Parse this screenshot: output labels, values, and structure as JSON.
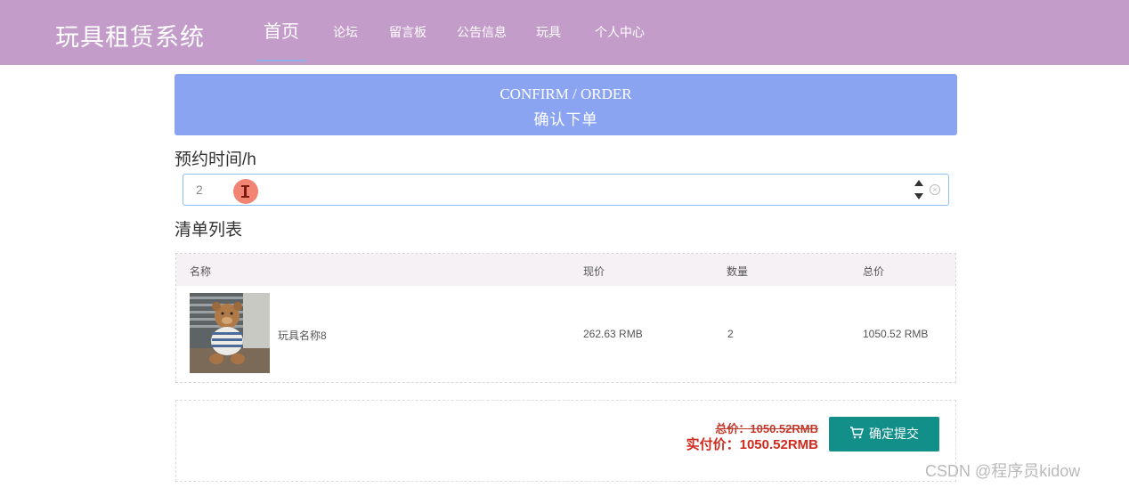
{
  "header": {
    "brand": "玩具租赁系统",
    "nav": [
      "首页",
      "论坛",
      "留言板",
      "公告信息",
      "玩具",
      "个人中心"
    ],
    "active_index": 0
  },
  "banner": {
    "title_en": "CONFIRM / ORDER",
    "title_cn": "确认下单"
  },
  "booking": {
    "label": "预约时间/h",
    "value": "2"
  },
  "list": {
    "label": "清单列表",
    "columns": [
      "名称",
      "现价",
      "数量",
      "总价"
    ],
    "rows": [
      {
        "name": "玩具名称8",
        "price": "262.63 RMB",
        "qty": "2",
        "total": "1050.52 RMB"
      }
    ]
  },
  "summary": {
    "total_label": "总价：1050.52RMB",
    "pay_label": "实付价：1050.52RMB",
    "submit_label": "确定提交"
  },
  "colors": {
    "header_bg": "#c39cca",
    "banner_bg": "#8ba4f2",
    "submit_bg": "#138f8a",
    "price_red": "#d02a1e"
  },
  "watermark": "CSDN @程序员kidow"
}
